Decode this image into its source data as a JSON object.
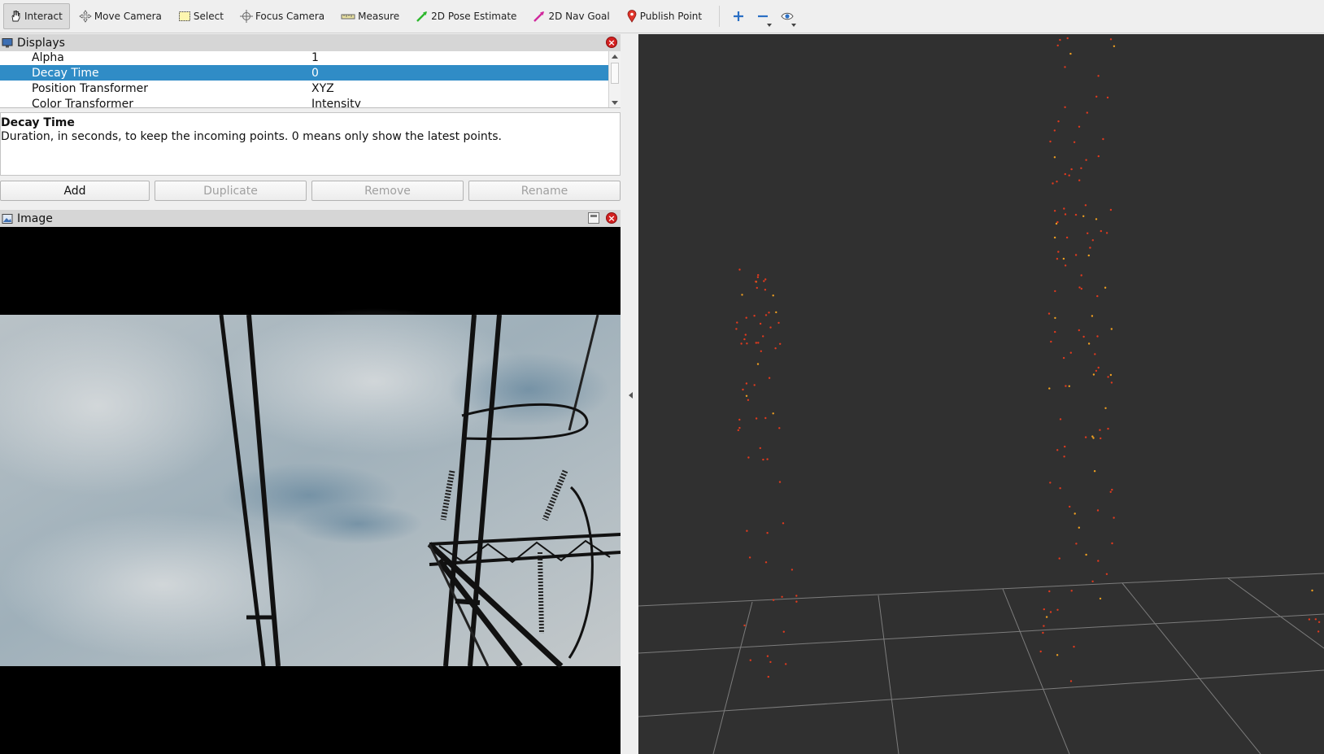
{
  "toolbar": {
    "tools": [
      {
        "label": "Interact",
        "icon": "hand-icon"
      },
      {
        "label": "Move Camera",
        "icon": "move-camera-icon"
      },
      {
        "label": "Select",
        "icon": "select-icon"
      },
      {
        "label": "Focus Camera",
        "icon": "focus-camera-icon"
      },
      {
        "label": "Measure",
        "icon": "ruler-icon"
      },
      {
        "label": "2D Pose Estimate",
        "icon": "green-arrow-icon"
      },
      {
        "label": "2D Nav Goal",
        "icon": "pink-arrow-icon"
      },
      {
        "label": "Publish Point",
        "icon": "map-pin-icon"
      }
    ],
    "extra_icons": [
      "plus-icon",
      "minus-icon",
      "eye-icon"
    ]
  },
  "displays_panel": {
    "title": "Displays",
    "properties": [
      {
        "key": "Alpha",
        "value": "1"
      },
      {
        "key": "Decay Time",
        "value": "0",
        "selected": true
      },
      {
        "key": "Position Transformer",
        "value": "XYZ"
      },
      {
        "key": "Color Transformer",
        "value": "Intensity"
      }
    ],
    "description_title": "Decay Time",
    "description_text": "Duration, in seconds, to keep the incoming points. 0 means only show the latest points.",
    "buttons": {
      "add": "Add",
      "duplicate": "Duplicate",
      "remove": "Remove",
      "rename": "Rename"
    }
  },
  "image_panel": {
    "title": "Image"
  },
  "colors": {
    "selection": "#308cc6",
    "viewport_bg": "#303030",
    "grid": "#8a8a8a",
    "point_red": "#e03a1e",
    "point_orange": "#f0a020"
  }
}
